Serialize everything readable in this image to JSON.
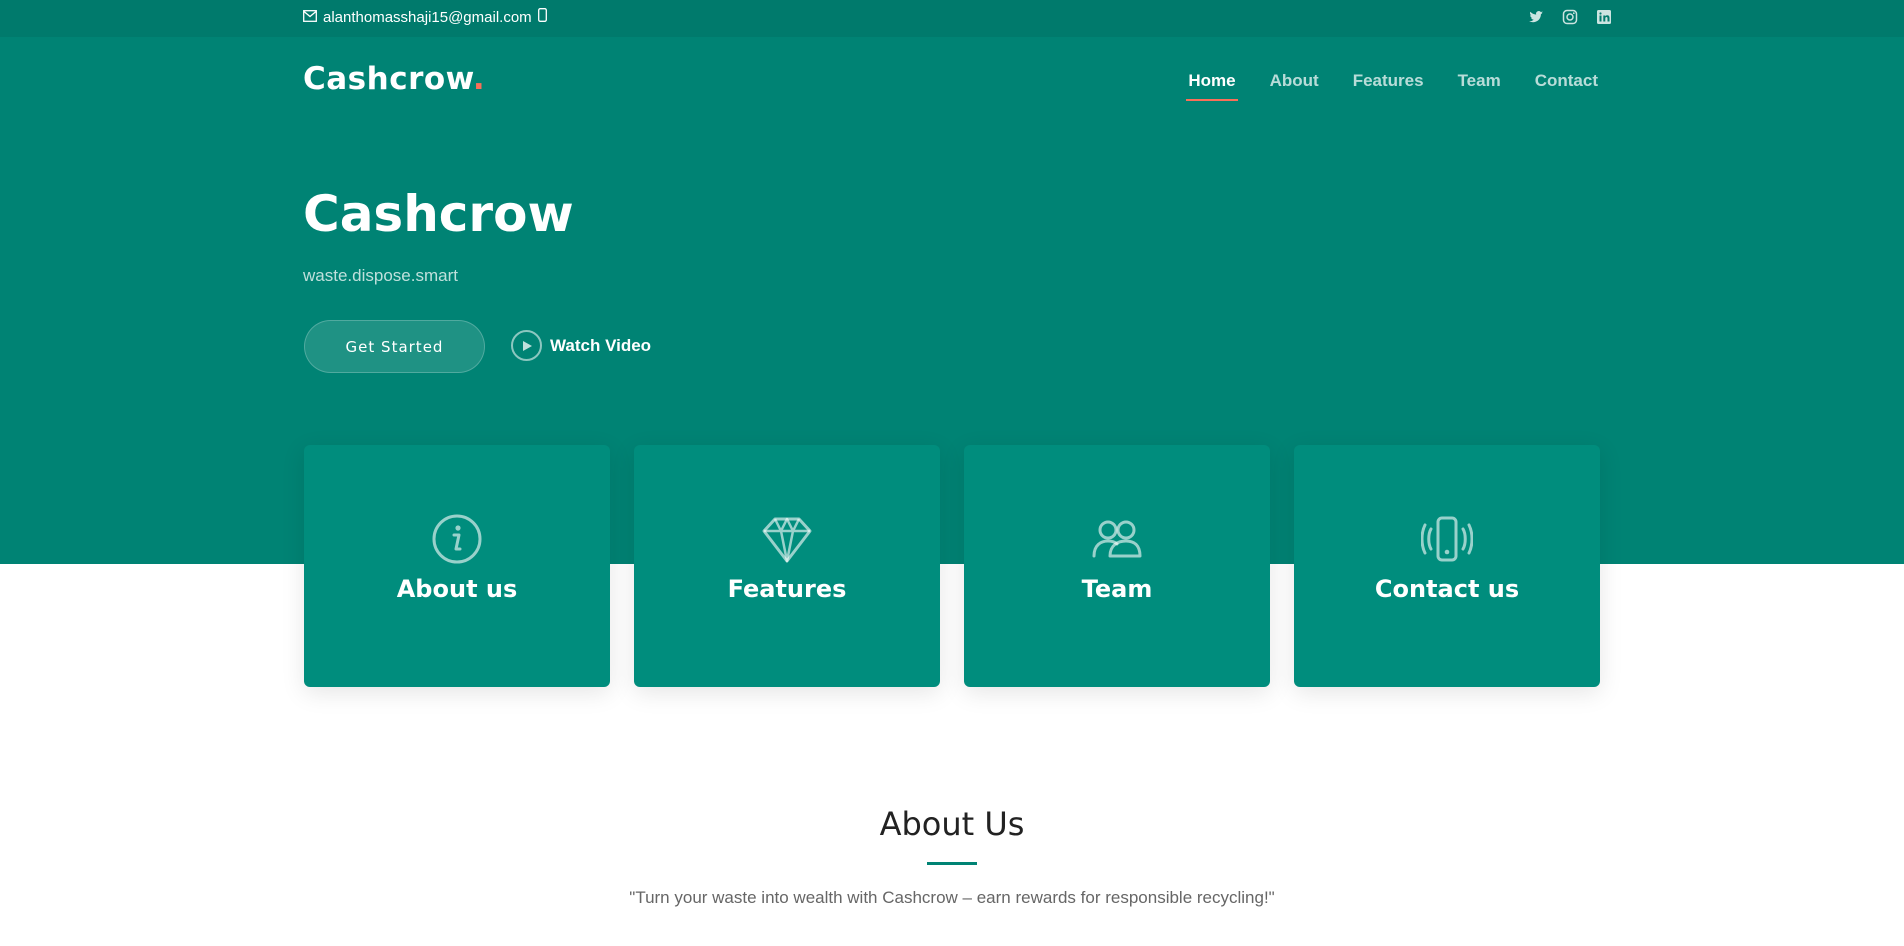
{
  "topbar": {
    "email": "alanthomasshaji15@gmail.com",
    "phone": "",
    "social": [
      "twitter-icon",
      "instagram-icon",
      "linkedin-icon"
    ]
  },
  "header": {
    "brand": "Cashcrow",
    "brand_dot": ".",
    "nav": [
      {
        "label": "Home",
        "active": true
      },
      {
        "label": "About",
        "active": false
      },
      {
        "label": "Features",
        "active": false
      },
      {
        "label": "Team",
        "active": false
      },
      {
        "label": "Contact",
        "active": false
      }
    ]
  },
  "hero": {
    "title": "Cashcrow",
    "subtitle": "waste.dispose.smart",
    "primary_button": "Get Started",
    "video_button": "Watch Video"
  },
  "cards": [
    {
      "label": "About us",
      "icon": "info-icon"
    },
    {
      "label": "Features",
      "icon": "diamond-icon"
    },
    {
      "label": "Team",
      "icon": "people-icon"
    },
    {
      "label": "Contact us",
      "icon": "phone-vibrate-icon"
    }
  ],
  "about": {
    "title": "About Us",
    "quote": "\"Turn your waste into wealth with Cashcrow – earn rewards for responsible recycling!\""
  },
  "colors": {
    "topbar": "#007a6c",
    "hero": "#008374",
    "card": "#008d7d",
    "accent": "#f96f59"
  }
}
